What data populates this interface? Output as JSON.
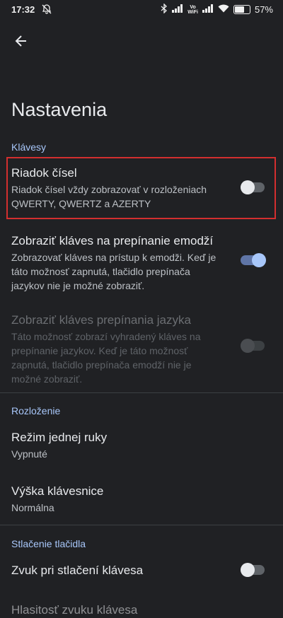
{
  "status_bar": {
    "time": "17:32",
    "battery": "57%",
    "vowifi_top": "Vo",
    "vowifi_bottom": "WiFi"
  },
  "page_title": "Nastavenia",
  "sections": {
    "keys": "Klávesy",
    "layout": "Rozloženie",
    "press": "Stlačenie tlačidla"
  },
  "items": {
    "number_row": {
      "title": "Riadok čísel",
      "subtitle": "Riadok čísel vždy zobrazovať v rozloženiach QWERTY, QWERTZ a AZERTY",
      "enabled": false
    },
    "emoji_key": {
      "title": "Zobraziť kláves na prepínanie emodží",
      "subtitle": "Zobrazovať kláves na prístup k emodži. Keď je táto možnosť zapnutá, tlačidlo prepínača jazykov nie je možné zobraziť.",
      "enabled": true
    },
    "language_key": {
      "title": "Zobraziť kláves prepínania jazyka",
      "subtitle": "Táto možnosť zobrazí vyhradený kláves na prepínanie jazykov. Keď je táto možnosť zapnutá, tlačidlo prepínača emodží nie je možné zobraziť.",
      "enabled": false,
      "disabled": true
    },
    "one_hand": {
      "title": "Režim jednej ruky",
      "subtitle": "Vypnuté"
    },
    "keyboard_height": {
      "title": "Výška klávesnice",
      "subtitle": "Normálna"
    },
    "key_sound": {
      "title": "Zvuk pri stlačení klávesa",
      "enabled": false
    },
    "key_volume": {
      "title": "Hlasitosť zvuku klávesa"
    }
  },
  "colors": {
    "accent": "#a8c7fa",
    "highlight": "#d32f2f",
    "background": "#202124"
  }
}
